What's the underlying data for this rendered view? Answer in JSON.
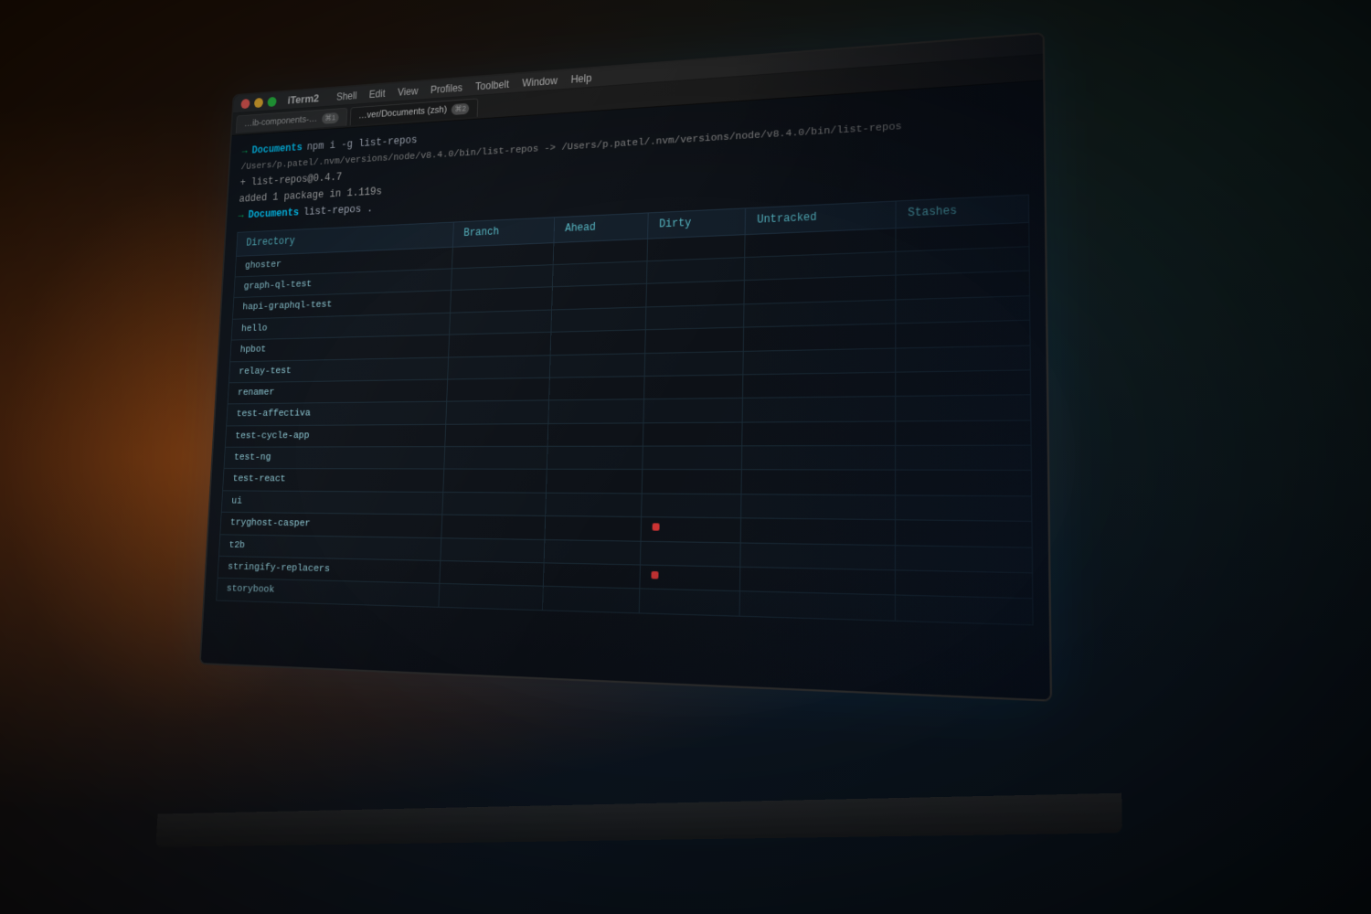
{
  "app": {
    "name": "iTerm2",
    "menu_items": [
      "Shell",
      "Edit",
      "View",
      "Profiles",
      "Toolbelt",
      "Window",
      "Help"
    ]
  },
  "tabs": [
    {
      "label": "…ib-components-…",
      "badge": "⌘1",
      "active": false
    },
    {
      "label": "…ver/Documents (zsh)",
      "badge": "⌘2",
      "active": true
    },
    {
      "label": "",
      "badge": "",
      "active": false
    }
  ],
  "terminal": {
    "prompt_symbol": "→",
    "commands": [
      {
        "dir": "Documents",
        "cmd": "npm i -g list-repos"
      }
    ],
    "output_lines": [
      "/Users/p.patel/.nvm/versions/node/v8.4.0/bin/list-repos -> /Users/p.patel/.nvm/versions/node/v8.4.0/bin/list-repos",
      "+ list-repos@0.4.7",
      "added 1 package in 1.119s"
    ],
    "prompt2": {
      "dir": "Documents",
      "cmd": "list-repos ."
    },
    "table": {
      "columns": [
        "Directory",
        "Branch",
        "Ahead",
        "Dirty",
        "Untracked",
        "Stashes"
      ],
      "rows": [
        {
          "dir": "ghoster",
          "branch": "",
          "ahead": "",
          "dirty": "",
          "untracked": "",
          "stashes": ""
        },
        {
          "dir": "graph-ql-test",
          "branch": "",
          "ahead": "",
          "dirty": "",
          "untracked": "",
          "stashes": ""
        },
        {
          "dir": "hapi-graphql-test",
          "branch": "",
          "ahead": "",
          "dirty": "",
          "untracked": "",
          "stashes": ""
        },
        {
          "dir": "hello",
          "branch": "",
          "ahead": "",
          "dirty": "",
          "untracked": "",
          "stashes": ""
        },
        {
          "dir": "hpbot",
          "branch": "",
          "ahead": "",
          "dirty": "",
          "untracked": "",
          "stashes": ""
        },
        {
          "dir": "relay-test",
          "branch": "",
          "ahead": "",
          "dirty": "",
          "untracked": "",
          "stashes": ""
        },
        {
          "dir": "renamer",
          "branch": "",
          "ahead": "",
          "dirty": "",
          "untracked": "",
          "stashes": ""
        },
        {
          "dir": "test-affectiva",
          "branch": "",
          "ahead": "",
          "dirty": "",
          "untracked": "",
          "stashes": ""
        },
        {
          "dir": "test-cycle-app",
          "branch": "",
          "ahead": "",
          "dirty": "",
          "untracked": "",
          "stashes": ""
        },
        {
          "dir": "test-ng",
          "branch": "",
          "ahead": "",
          "dirty": "",
          "untracked": "",
          "stashes": ""
        },
        {
          "dir": "test-react",
          "branch": "",
          "ahead": "",
          "dirty": "",
          "untracked": "",
          "stashes": ""
        },
        {
          "dir": "ui",
          "branch": "",
          "ahead": "",
          "dirty": "",
          "untracked": "",
          "stashes": ""
        },
        {
          "dir": "tryghost-casper",
          "branch": "",
          "ahead": "",
          "dirty": "●",
          "untracked": "",
          "stashes": ""
        },
        {
          "dir": "t2b",
          "branch": "",
          "ahead": "",
          "dirty": "",
          "untracked": "",
          "stashes": ""
        },
        {
          "dir": "stringify-replacers",
          "branch": "",
          "ahead": "",
          "dirty": "●",
          "untracked": "",
          "stashes": ""
        },
        {
          "dir": "storybook",
          "branch": "",
          "ahead": "",
          "dirty": "",
          "untracked": "",
          "stashes": ""
        }
      ]
    }
  }
}
